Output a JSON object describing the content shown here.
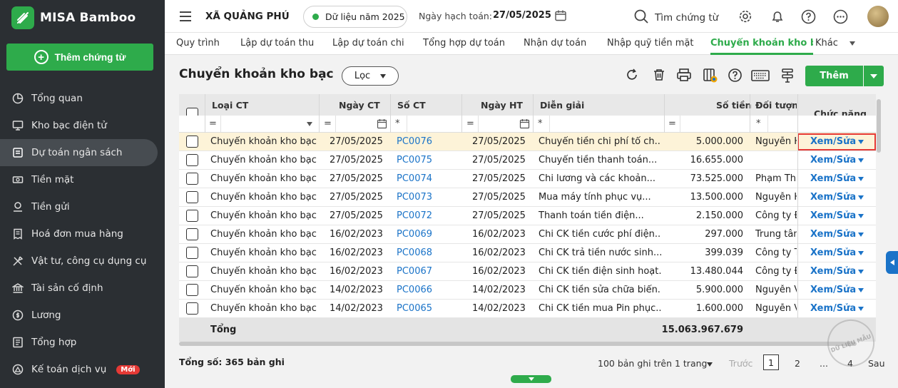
{
  "app": {
    "name": "MISA Bamboo",
    "add_button": "Thêm chứng từ"
  },
  "sidebar": {
    "items": [
      {
        "label": "Tổng quan",
        "icon": "pie-chart-icon",
        "active": false
      },
      {
        "label": "Kho bạc điện tử",
        "icon": "monitor-icon",
        "active": false
      },
      {
        "label": "Dự toán ngân sách",
        "icon": "budget-icon",
        "active": true
      },
      {
        "label": "Tiền mặt",
        "icon": "cash-icon",
        "active": false
      },
      {
        "label": "Tiền gửi",
        "icon": "deposit-icon",
        "active": false
      },
      {
        "label": "Hoá đơn mua hàng",
        "icon": "invoice-icon",
        "active": false
      },
      {
        "label": "Vật tư, công cụ dụng cụ",
        "icon": "tools-icon",
        "active": false
      },
      {
        "label": "Tài sản cố định",
        "icon": "bank-building-icon",
        "active": false
      },
      {
        "label": "Lương",
        "icon": "salary-icon",
        "active": false
      },
      {
        "label": "Tổng hợp",
        "icon": "summary-icon",
        "active": false
      },
      {
        "label": "Kế toán dịch vụ",
        "icon": "service-icon",
        "active": false,
        "badge": "Mới"
      }
    ]
  },
  "topbar": {
    "org": "XÃ QUẢNG PHÚ",
    "data_year": "Dữ liệu năm 2025",
    "posting_date_label": "Ngày hạch toán:",
    "posting_date": "27/05/2025",
    "search_label": "Tìm chứng từ"
  },
  "tabs": [
    {
      "label": "Quy trình"
    },
    {
      "label": "Lập dự toán thu"
    },
    {
      "label": "Lập dự toán chi"
    },
    {
      "label": "Tổng hợp dự toán"
    },
    {
      "label": "Nhận dự toán"
    },
    {
      "label": "Nhập quỹ tiền mặt"
    },
    {
      "label": "Chuyển khoản kho bạc",
      "active": true
    },
    {
      "label": "Khác"
    }
  ],
  "page": {
    "title": "Chuyển khoản kho bạc",
    "filter_label": "Lọc",
    "add_label": "Thêm"
  },
  "table": {
    "headers": [
      "Loại CT",
      "Ngày CT",
      "Số CT",
      "Ngày HT",
      "Diễn giải",
      "Số tiền",
      "Đối tượng",
      "Chức năng"
    ],
    "filter_ops": [
      "=",
      "=",
      "*",
      "=",
      "*",
      "=",
      "*"
    ],
    "rows": [
      {
        "type": "Chuyển khoản kho bạc",
        "date": "27/05/2025",
        "no": "PC0076",
        "post": "27/05/2025",
        "desc": "Chuyển tiền chi phí tổ ch...",
        "amount": "5.000.000",
        "obj": "Nguyễn H",
        "action": "Xem/Sửa",
        "selected": true
      },
      {
        "type": "Chuyển khoản kho bạc",
        "date": "27/05/2025",
        "no": "PC0075",
        "post": "27/05/2025",
        "desc": "Chuyển tiền thanh toán...",
        "amount": "16.655.000",
        "obj": "",
        "action": "Xem/Sửa"
      },
      {
        "type": "Chuyển khoản kho bạc",
        "date": "27/05/2025",
        "no": "PC0074",
        "post": "27/05/2025",
        "desc": "Chi lương và các khoản...",
        "amount": "73.525.000",
        "obj": "Phạm Thu",
        "action": "Xem/Sửa"
      },
      {
        "type": "Chuyển khoản kho bạc",
        "date": "27/05/2025",
        "no": "PC0073",
        "post": "27/05/2025",
        "desc": "Mua máy tính phục vụ...",
        "amount": "13.500.000",
        "obj": "Nguyễn H",
        "action": "Xem/Sửa"
      },
      {
        "type": "Chuyển khoản kho bạc",
        "date": "27/05/2025",
        "no": "PC0072",
        "post": "27/05/2025",
        "desc": "Thanh toán tiền điện...",
        "amount": "2.150.000",
        "obj": "Công ty Đ",
        "action": "Xem/Sửa"
      },
      {
        "type": "Chuyển khoản kho bạc",
        "date": "16/02/2023",
        "no": "PC0069",
        "post": "16/02/2023",
        "desc": "Chi CK tiền cước phí điện...",
        "amount": "297.000",
        "obj": "Trung tâm",
        "action": "Xem/Sửa"
      },
      {
        "type": "Chuyển khoản kho bạc",
        "date": "16/02/2023",
        "no": "PC0068",
        "post": "16/02/2023",
        "desc": "Chi CK trả tiền nước sinh...",
        "amount": "399.039",
        "obj": "Công ty T",
        "action": "Xem/Sửa"
      },
      {
        "type": "Chuyển khoản kho bạc",
        "date": "16/02/2023",
        "no": "PC0067",
        "post": "16/02/2023",
        "desc": "Chi CK tiền điện sinh hoạt...",
        "amount": "13.480.044",
        "obj": "Công ty Đ",
        "action": "Xem/Sửa"
      },
      {
        "type": "Chuyển khoản kho bạc",
        "date": "14/02/2023",
        "no": "PC0066",
        "post": "14/02/2023",
        "desc": "Chi CK tiền sửa chữa biển...",
        "amount": "5.900.000",
        "obj": "Nguyễn V",
        "action": "Xem/Sửa"
      },
      {
        "type": "Chuyển khoản kho bạc",
        "date": "14/02/2023",
        "no": "PC0065",
        "post": "14/02/2023",
        "desc": "Chi CK tiền mua Pin phục...",
        "amount": "1.600.000",
        "obj": "Nguyễn V",
        "action": "Xem/Sửa"
      }
    ],
    "total_label": "Tổng",
    "total_amount": "15.063.967.679"
  },
  "footer": {
    "record_count": "Tổng số: 365 bản ghi",
    "page_size": "100 bản ghi trên 1 trang",
    "prev": "Trước",
    "pages": [
      "1",
      "2",
      "...",
      "4"
    ],
    "next": "Sau"
  },
  "watermark": "DỮ LIỆU MẪU",
  "colors": {
    "brand": "#2eab4b",
    "sidebar": "#2b2f33",
    "link": "#1a73c8",
    "highlight": "#e53935"
  }
}
